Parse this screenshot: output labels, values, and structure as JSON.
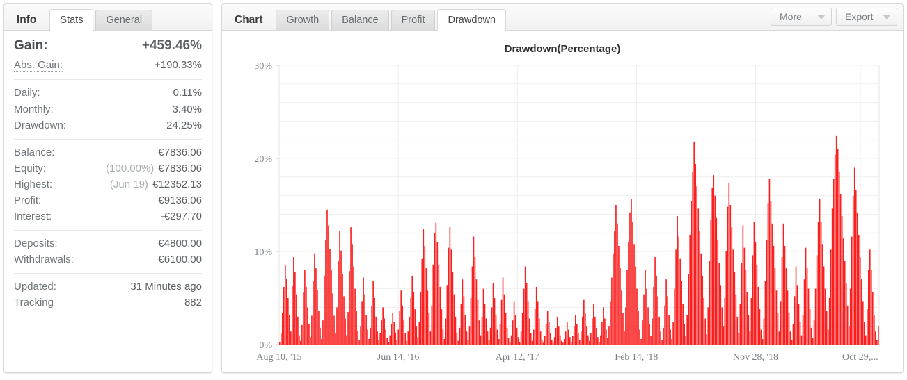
{
  "left_panel": {
    "tabs": [
      {
        "label": "Info",
        "state": "head"
      },
      {
        "label": "Stats",
        "state": "active"
      },
      {
        "label": "General",
        "state": "inactive"
      }
    ],
    "groups": [
      {
        "rows": [
          {
            "label": "Gain:",
            "value": "+459.46%",
            "style": "big",
            "value_color": "positive",
            "dotted": true
          },
          {
            "label": "Abs. Gain:",
            "value": "+190.33%",
            "style": "norm",
            "value_color": "positive",
            "dotted": true
          }
        ]
      },
      {
        "rows": [
          {
            "label": "Daily:",
            "value": "0.11%",
            "style": "norm",
            "value_color": "normal",
            "dotted": true
          },
          {
            "label": "Monthly:",
            "value": "3.40%",
            "style": "norm",
            "value_color": "normal",
            "dotted": true
          },
          {
            "label": "Drawdown:",
            "value": "24.25%",
            "style": "norm",
            "value_color": "normal",
            "dotted": false
          }
        ]
      },
      {
        "rows": [
          {
            "label": "Balance:",
            "value": "€7836.06",
            "style": "norm",
            "value_color": "normal",
            "dotted": false
          },
          {
            "label": "Equity:",
            "value": "€7836.06",
            "prefix": "(100.00%)",
            "style": "norm",
            "value_color": "normal",
            "dotted": false
          },
          {
            "label": "Highest:",
            "value": "€12352.13",
            "prefix": "(Jun 19)",
            "style": "norm",
            "value_color": "normal",
            "dotted": false
          },
          {
            "label": "Profit:",
            "value": "€9136.06",
            "style": "norm",
            "value_color": "positive",
            "dotted": false
          },
          {
            "label": "Interest:",
            "value": "-€297.70",
            "style": "norm",
            "value_color": "normal",
            "dotted": false
          }
        ]
      },
      {
        "rows": [
          {
            "label": "Deposits:",
            "value": "€4800.00",
            "style": "norm",
            "value_color": "normal",
            "dotted": false
          },
          {
            "label": "Withdrawals:",
            "value": "€6100.00",
            "style": "norm",
            "value_color": "normal",
            "dotted": false
          }
        ]
      },
      {
        "rows": [
          {
            "label": "Updated:",
            "value": "31 Minutes ago",
            "style": "norm",
            "value_color": "normal",
            "dotted": false
          },
          {
            "label": "Tracking",
            "value": "882",
            "style": "norm",
            "value_color": "normal",
            "dotted": false
          }
        ]
      }
    ]
  },
  "chart_panel": {
    "tabs": [
      {
        "label": "Chart",
        "state": "head"
      },
      {
        "label": "Growth",
        "state": "inactive"
      },
      {
        "label": "Balance",
        "state": "inactive"
      },
      {
        "label": "Profit",
        "state": "inactive"
      },
      {
        "label": "Drawdown",
        "state": "active"
      }
    ],
    "buttons": [
      {
        "label": "More",
        "icon": "chevron-down-icon"
      },
      {
        "label": "Export",
        "icon": "chevron-down-icon"
      }
    ]
  },
  "chart_data": {
    "type": "bar",
    "title": "Drawdown(Percentage)",
    "xlabel": "",
    "ylabel": "",
    "ylim": [
      0,
      30
    ],
    "yticks": [
      0,
      10,
      20,
      30
    ],
    "ytick_labels": [
      "0%",
      "10%",
      "20%",
      "30%"
    ],
    "minor_gridline_step": 2,
    "grid": true,
    "legend": false,
    "bar_color": "#fa2020",
    "xtick_labels": [
      "Aug 10, '15",
      "Jun 14, '16",
      "Apr 12, '17",
      "Feb 14, '18",
      "Nov 28, '18",
      "Oct 29,..."
    ],
    "xtick_positions": [
      0,
      0.1985,
      0.397,
      0.5955,
      0.794,
      0.9685
    ],
    "series_name": "Drawdown %",
    "n_points": 430,
    "values": [
      0.3,
      1.2,
      3.4,
      6.2,
      8.6,
      7.1,
      5.0,
      3.2,
      1.4,
      6.3,
      9.4,
      7.8,
      5.4,
      3.0,
      1.0,
      0.4,
      2.1,
      5.6,
      8.0,
      6.2,
      4.0,
      2.2,
      0.8,
      3.1,
      6.8,
      9.8,
      8.2,
      5.9,
      3.6,
      1.8,
      0.6,
      2.6,
      7.4,
      11.2,
      14.5,
      12.8,
      10.3,
      8.0,
      5.5,
      3.1,
      1.2,
      4.0,
      9.0,
      12.2,
      10.1,
      7.6,
      5.2,
      2.8,
      1.0,
      3.5,
      7.9,
      12.6,
      10.8,
      8.4,
      6.0,
      3.6,
      1.5,
      0.5,
      2.0,
      4.6,
      7.2,
      5.4,
      3.2,
      1.6,
      0.6,
      1.8,
      4.2,
      6.8,
      5.0,
      3.0,
      1.4,
      0.5,
      1.2,
      2.6,
      4.0,
      2.8,
      1.6,
      0.7,
      0.3,
      1.0,
      2.2,
      3.4,
      2.4,
      1.3,
      0.5,
      1.6,
      3.6,
      5.8,
      4.2,
      2.6,
      1.2,
      0.4,
      1.4,
      3.0,
      5.0,
      7.4,
      5.6,
      3.8,
      2.0,
      0.8,
      2.4,
      5.6,
      9.2,
      12.4,
      10.6,
      8.2,
      5.8,
      3.4,
      1.4,
      4.2,
      8.6,
      12.0,
      13.1,
      11.0,
      8.6,
      6.2,
      3.8,
      1.6,
      0.6,
      2.8,
      6.4,
      10.4,
      12.6,
      10.2,
      7.8,
      5.4,
      3.0,
      1.2,
      0.4,
      1.8,
      4.4,
      7.0,
      5.2,
      3.2,
      1.4,
      0.5,
      2.0,
      5.0,
      8.4,
      11.6,
      9.4,
      7.0,
      4.8,
      2.6,
      1.0,
      3.0,
      6.0,
      4.4,
      2.8,
      1.4,
      0.5,
      1.8,
      4.0,
      6.6,
      5.0,
      3.2,
      1.6,
      0.6,
      2.2,
      4.8,
      7.2,
      5.4,
      3.4,
      1.8,
      0.7,
      0.3,
      1.0,
      2.6,
      4.6,
      3.2,
      1.8,
      0.8,
      0.3,
      1.4,
      3.4,
      6.0,
      8.4,
      6.6,
      4.6,
      2.8,
      1.2,
      0.4,
      1.6,
      3.8,
      6.2,
      4.6,
      2.8,
      1.4,
      0.5,
      0.2,
      0.9,
      2.2,
      3.6,
      2.4,
      1.2,
      0.5,
      0.2,
      0.8,
      1.8,
      3.0,
      2.0,
      1.0,
      0.4,
      0.2,
      0.6,
      1.4,
      2.4,
      1.6,
      0.8,
      0.3,
      0.9,
      2.0,
      3.2,
      2.2,
      1.2,
      0.5,
      1.4,
      3.0,
      4.8,
      3.4,
      2.0,
      1.0,
      0.4,
      1.2,
      2.8,
      4.4,
      3.0,
      1.8,
      0.8,
      0.3,
      1.0,
      2.4,
      4.0,
      2.8,
      1.6,
      0.7,
      2.0,
      4.6,
      7.2,
      9.8,
      12.2,
      15.0,
      13.0,
      10.6,
      8.2,
      5.8,
      3.4,
      1.4,
      4.0,
      8.0,
      11.0,
      14.2,
      15.6,
      13.2,
      10.8,
      8.4,
      6.0,
      3.6,
      1.6,
      0.6,
      2.6,
      5.4,
      8.0,
      6.0,
      4.0,
      2.2,
      0.9,
      2.8,
      6.2,
      9.4,
      7.4,
      5.2,
      3.0,
      1.4,
      0.5,
      1.8,
      4.2,
      7.0,
      5.2,
      3.2,
      1.6,
      0.6,
      2.4,
      6.0,
      10.2,
      13.8,
      11.6,
      9.2,
      6.8,
      4.4,
      2.2,
      0.9,
      3.2,
      7.6,
      11.8,
      15.4,
      18.6,
      21.8,
      19.4,
      17.0,
      14.6,
      12.2,
      9.8,
      7.4,
      5.0,
      2.8,
      1.1,
      4.0,
      9.0,
      13.4,
      16.8,
      18.2,
      16.0,
      13.6,
      11.2,
      8.8,
      6.4,
      4.0,
      2.0,
      5.0,
      10.0,
      14.8,
      17.4,
      15.0,
      12.6,
      10.2,
      7.8,
      5.4,
      3.0,
      1.2,
      4.4,
      8.8,
      12.8,
      10.4,
      8.0,
      5.6,
      3.2,
      1.4,
      5.0,
      9.6,
      13.2,
      11.0,
      8.6,
      6.2,
      3.8,
      1.6,
      0.6,
      2.8,
      6.8,
      11.2,
      15.2,
      17.8,
      15.4,
      13.0,
      10.6,
      8.2,
      5.8,
      3.4,
      1.4,
      4.6,
      9.4,
      13.0,
      10.6,
      8.2,
      5.8,
      3.4,
      1.4,
      0.5,
      2.2,
      5.2,
      8.4,
      6.4,
      4.4,
      2.4,
      1.0,
      3.2,
      7.0,
      10.4,
      8.2,
      6.0,
      3.8,
      1.8,
      0.7,
      2.6,
      6.0,
      9.6,
      13.2,
      15.6,
      13.2,
      10.8,
      8.4,
      6.0,
      3.6,
      1.6,
      5.0,
      10.2,
      14.6,
      17.8,
      20.4,
      22.4,
      21.0,
      18.6,
      16.2,
      13.8,
      11.4,
      9.0,
      6.6,
      4.2,
      2.0,
      6.0,
      11.6,
      16.0,
      19.0,
      16.6,
      14.2,
      11.8,
      9.4,
      7.0,
      4.6,
      2.4,
      1.0,
      3.8,
      8.0,
      10.2,
      8.0,
      5.6,
      3.2,
      1.4,
      0.5,
      2.0
    ]
  }
}
